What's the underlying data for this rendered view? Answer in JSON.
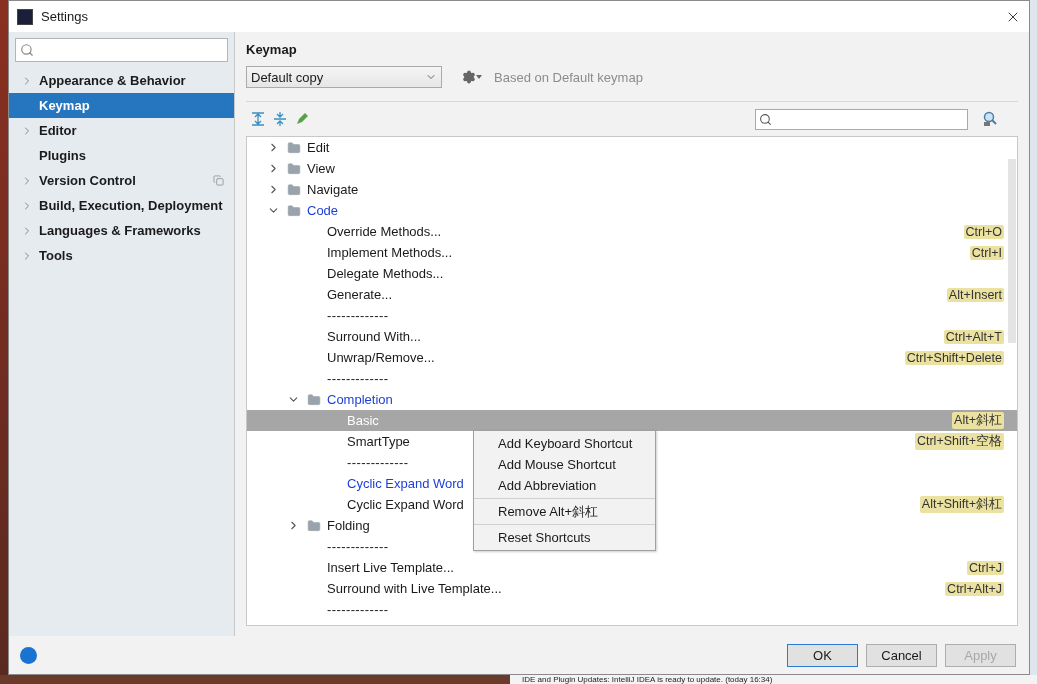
{
  "window": {
    "title": "Settings"
  },
  "sidebar": {
    "items": [
      {
        "label": "Appearance & Behavior",
        "expandable": true,
        "selected": false,
        "project_scoped": false
      },
      {
        "label": "Keymap",
        "expandable": false,
        "selected": true,
        "project_scoped": false
      },
      {
        "label": "Editor",
        "expandable": true,
        "selected": false,
        "project_scoped": false
      },
      {
        "label": "Plugins",
        "expandable": false,
        "selected": false,
        "project_scoped": false
      },
      {
        "label": "Version Control",
        "expandable": true,
        "selected": false,
        "project_scoped": true
      },
      {
        "label": "Build, Execution, Deployment",
        "expandable": true,
        "selected": false,
        "project_scoped": false
      },
      {
        "label": "Languages & Frameworks",
        "expandable": true,
        "selected": false,
        "project_scoped": false
      },
      {
        "label": "Tools",
        "expandable": true,
        "selected": false,
        "project_scoped": false
      }
    ]
  },
  "keymap": {
    "title": "Keymap",
    "scheme": "Default copy",
    "based_on": "Based on Default keymap",
    "tree": [
      {
        "kind": "folder",
        "label": "Edit",
        "expanded": false,
        "selected": false,
        "modified": false
      },
      {
        "kind": "folder",
        "label": "View",
        "expanded": false,
        "selected": false,
        "modified": false
      },
      {
        "kind": "folder",
        "label": "Navigate",
        "expanded": false,
        "selected": false,
        "modified": false
      },
      {
        "kind": "folder",
        "label": "Code",
        "expanded": true,
        "selected": false,
        "modified": true,
        "children": [
          {
            "kind": "action",
            "label": "Override Methods...",
            "shortcut": "Ctrl+O",
            "selected": false,
            "modified": false
          },
          {
            "kind": "action",
            "label": "Implement Methods...",
            "shortcut": "Ctrl+I",
            "selected": false,
            "modified": false
          },
          {
            "kind": "action",
            "label": "Delegate Methods...",
            "selected": false,
            "modified": false
          },
          {
            "kind": "action",
            "label": "Generate...",
            "shortcut": "Alt+Insert",
            "selected": false,
            "modified": false
          },
          {
            "kind": "separator",
            "label": "-------------",
            "selected": false,
            "modified": false
          },
          {
            "kind": "action",
            "label": "Surround With...",
            "shortcut": "Ctrl+Alt+T",
            "selected": false,
            "modified": false
          },
          {
            "kind": "action",
            "label": "Unwrap/Remove...",
            "shortcut": "Ctrl+Shift+Delete",
            "selected": false,
            "modified": false
          },
          {
            "kind": "separator",
            "label": "-------------",
            "selected": false,
            "modified": false
          },
          {
            "kind": "folder",
            "label": "Completion",
            "expanded": true,
            "selected": false,
            "modified": true,
            "children": [
              {
                "kind": "action",
                "label": "Basic",
                "shortcut": "Alt+斜杠",
                "selected": true,
                "modified": false
              },
              {
                "kind": "action",
                "label": "SmartType",
                "shortcut": "Ctrl+Shift+空格",
                "selected": false,
                "modified": false
              },
              {
                "kind": "separator",
                "label": "-------------",
                "selected": false,
                "modified": false
              },
              {
                "kind": "action",
                "label": "Cyclic Expand Word",
                "selected": false,
                "modified": true
              },
              {
                "kind": "action",
                "label": "Cyclic Expand Word",
                "shortcut": "Alt+Shift+斜杠",
                "selected": false,
                "modified": false
              }
            ]
          },
          {
            "kind": "folder",
            "label": "Folding",
            "expanded": false,
            "selected": false,
            "modified": false
          },
          {
            "kind": "separator",
            "label": "-------------",
            "selected": false,
            "modified": false
          },
          {
            "kind": "action",
            "label": "Insert Live Template...",
            "shortcut": "Ctrl+J",
            "selected": false,
            "modified": false
          },
          {
            "kind": "action",
            "label": "Surround with Live Template...",
            "shortcut": "Ctrl+Alt+J",
            "selected": false,
            "modified": false
          },
          {
            "kind": "separator",
            "label": "-------------",
            "selected": false,
            "modified": false
          }
        ]
      }
    ]
  },
  "context_menu": [
    {
      "kind": "item",
      "label": "Add Keyboard Shortcut"
    },
    {
      "kind": "item",
      "label": "Add Mouse Shortcut"
    },
    {
      "kind": "item",
      "label": "Add Abbreviation"
    },
    {
      "kind": "separator"
    },
    {
      "kind": "item",
      "label": "Remove Alt+斜杠"
    },
    {
      "kind": "separator"
    },
    {
      "kind": "item",
      "label": "Reset Shortcuts"
    }
  ],
  "buttons": [
    {
      "label": "OK",
      "default": true,
      "disabled": false
    },
    {
      "label": "Cancel",
      "default": false,
      "disabled": false
    },
    {
      "label": "Apply",
      "default": false,
      "disabled": true
    }
  ],
  "notification": "IDE and Plugin Updates: IntelliJ IDEA is ready to update. (today 16:34)"
}
